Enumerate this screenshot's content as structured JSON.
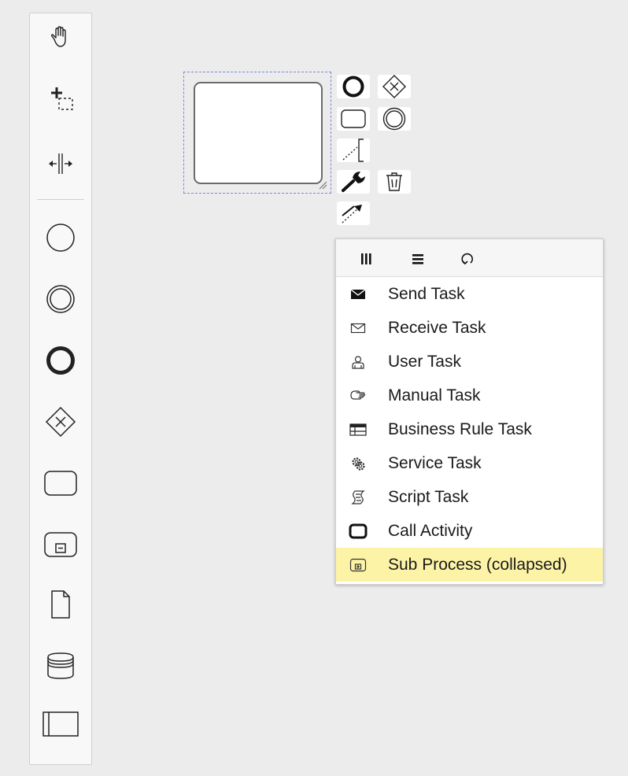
{
  "palette": {
    "tools": [
      {
        "name": "hand-tool",
        "icon": "hand-icon"
      },
      {
        "name": "lasso-tool",
        "icon": "lasso-icon"
      },
      {
        "name": "space-tool",
        "icon": "space-tool-icon"
      },
      {
        "name": "create-start-event",
        "icon": "start-event-icon"
      },
      {
        "name": "create-intermediate-event",
        "icon": "intermediate-event-icon"
      },
      {
        "name": "create-end-event",
        "icon": "end-event-icon"
      },
      {
        "name": "create-gateway",
        "icon": "exclusive-gateway-icon"
      },
      {
        "name": "create-task",
        "icon": "task-icon"
      },
      {
        "name": "create-subprocess",
        "icon": "subprocess-collapsed-icon"
      },
      {
        "name": "create-data-object",
        "icon": "data-object-icon"
      },
      {
        "name": "create-data-store",
        "icon": "data-store-icon"
      },
      {
        "name": "create-pool",
        "icon": "participant-icon"
      }
    ]
  },
  "context_pad": {
    "entries": [
      {
        "name": "append-end-event",
        "icon": "end-event-icon"
      },
      {
        "name": "append-gateway",
        "icon": "exclusive-gateway-icon"
      },
      {
        "name": "append-task",
        "icon": "task-icon"
      },
      {
        "name": "append-intermediate-event",
        "icon": "intermediate-event-icon"
      },
      {
        "name": "append-text-annotation",
        "icon": "text-annotation-icon"
      },
      {
        "name": "replace",
        "icon": "wrench-icon"
      },
      {
        "name": "delete",
        "icon": "trash-icon"
      },
      {
        "name": "connect",
        "icon": "connection-icon"
      }
    ]
  },
  "replace_menu": {
    "header": [
      {
        "name": "parallel-multi-instance",
        "icon": "parallel-mi-marker-icon"
      },
      {
        "name": "sequential-multi-instance",
        "icon": "sequential-mi-marker-icon"
      },
      {
        "name": "loop",
        "icon": "loop-marker-icon"
      }
    ],
    "items": [
      {
        "label": "Send Task",
        "icon": "send-task-icon",
        "selected": false
      },
      {
        "label": "Receive Task",
        "icon": "receive-task-icon",
        "selected": false
      },
      {
        "label": "User Task",
        "icon": "user-task-icon",
        "selected": false
      },
      {
        "label": "Manual Task",
        "icon": "manual-task-icon",
        "selected": false
      },
      {
        "label": "Business Rule Task",
        "icon": "business-rule-task-icon",
        "selected": false
      },
      {
        "label": "Service Task",
        "icon": "service-task-icon",
        "selected": false
      },
      {
        "label": "Script Task",
        "icon": "script-task-icon",
        "selected": false
      },
      {
        "label": "Call Activity",
        "icon": "call-activity-icon",
        "selected": false
      },
      {
        "label": "Sub Process (collapsed)",
        "icon": "subprocess-collapsed-icon",
        "selected": true
      }
    ],
    "selected_color": "#fcf3a6"
  }
}
